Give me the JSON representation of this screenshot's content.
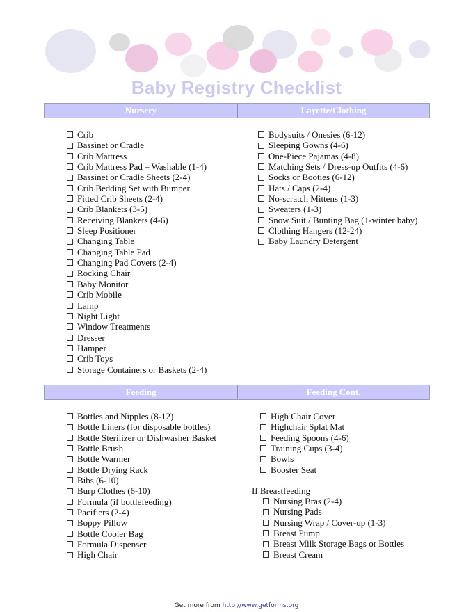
{
  "title": "Baby Registry Checklist",
  "colors": {
    "title": "#c9c9f2",
    "header_bg": "#c8c8fa",
    "header_text": "#ffffff",
    "link": "#3333aa"
  },
  "sections": {
    "top": {
      "left_header": "Nursery",
      "right_header": "Layette/Clothing",
      "nursery": [
        "Crib",
        "Bassinet or Cradle",
        "Crib Mattress",
        "Crib Mattress Pad – Washable (1-4)",
        "Bassinet or Cradle Sheets (2-4)",
        "Crib Bedding Set with Bumper",
        "Fitted Crib Sheets (2-4)",
        "Crib Blankets (3-5)",
        "Receiving Blankets (4-6)",
        "Sleep Positioner",
        "Changing Table",
        "Changing Table Pad",
        "Changing Pad Covers (2-4)",
        "Rocking Chair",
        "Baby Monitor",
        "Crib Mobile",
        "Lamp",
        "Night Light",
        "Window Treatments",
        "Dresser",
        "Hamper",
        "Crib Toys",
        "Storage Containers or Baskets (2-4)"
      ],
      "layette": [
        "Bodysuits / Onesies (6-12)",
        "Sleeping Gowns (4-6)",
        "One-Piece Pajamas (4-8)",
        "Matching Sets / Dress-up Outfits (4-6)",
        "Socks or Booties (6-12)",
        "Hats / Caps (2-4)",
        "No-scratch Mittens (1-3)",
        "Sweaters (1-3)",
        "Snow Suit / Bunting Bag (1-winter baby)",
        "Clothing Hangers (12-24)",
        "Baby Laundry Detergent"
      ]
    },
    "bottom": {
      "left_header": "Feeding",
      "right_header": "Feeding Cont.",
      "feeding": [
        "Bottles and Nipples (8-12)",
        "Bottle Liners (for disposable bottles)",
        "Bottle Sterilizer or Dishwasher Basket",
        "Bottle Brush",
        "Bottle Warmer",
        "Bottle Drying Rack",
        "Bibs (6-10)",
        "Burp Clothes (6-10)",
        "Formula (if bottlefeeding)",
        "Pacifiers (2-4)",
        "Boppy Pillow",
        "Bottle Cooler Bag",
        "Formula Dispenser",
        "High Chair"
      ],
      "feeding_cont": [
        "High Chair Cover",
        "Highchair Splat Mat",
        "Feeding Spoons (4-6)",
        "Training Cups (3-4)",
        "Bowls",
        "Booster Seat"
      ],
      "breastfeeding_label": "If Breastfeeding",
      "breastfeeding": [
        "Nursing Bras (2-4)",
        "Nursing Pads",
        "Nursing Wrap / Cover-up (1-3)",
        "Breast Pump",
        "Breast Milk Storage Bags or Bottles",
        "Breast Cream"
      ]
    }
  },
  "footer": {
    "prefix": "Get more from ",
    "link_text": "http://www.getforms.org"
  }
}
